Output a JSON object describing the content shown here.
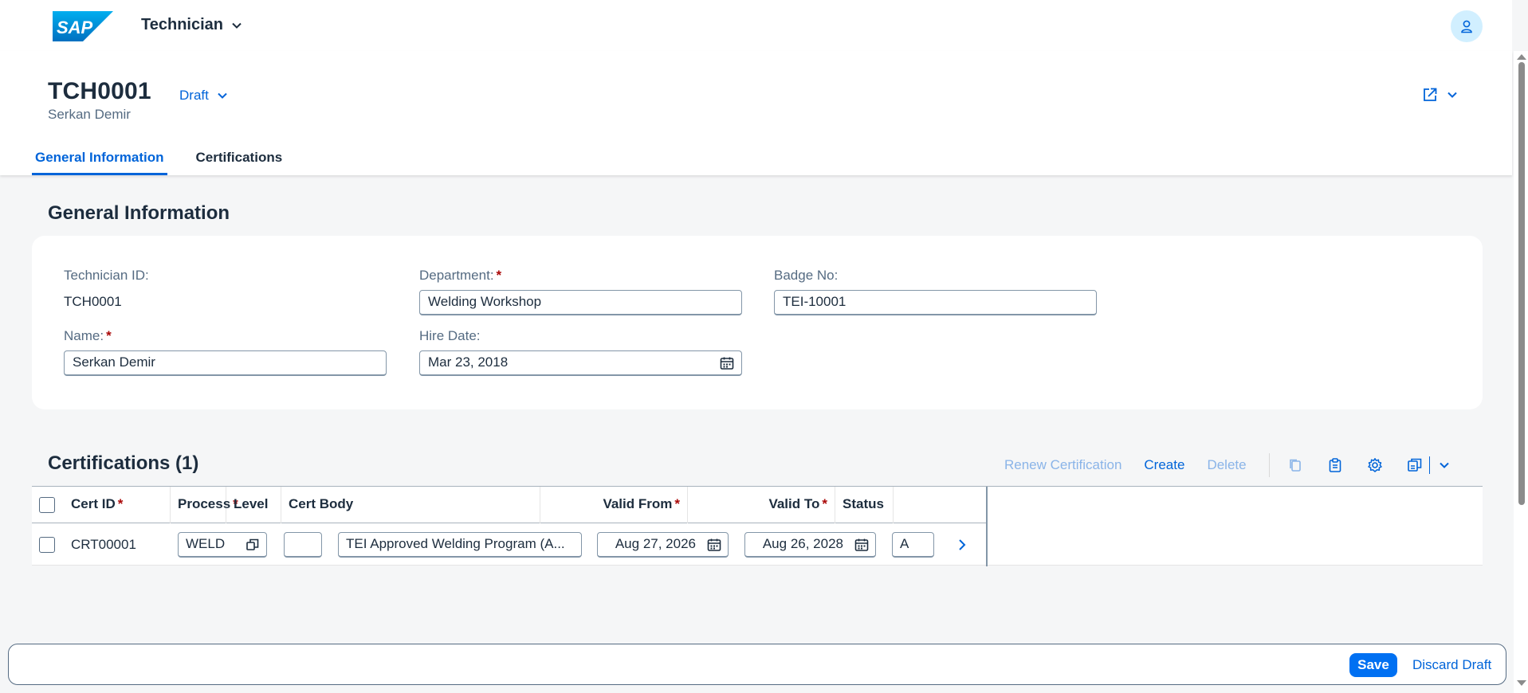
{
  "shell": {
    "logo": "SAP",
    "app_title": "Technician"
  },
  "header": {
    "title": "TCH0001",
    "subtitle": "Serkan Demir",
    "draft_label": "Draft",
    "tabs": [
      {
        "label": "General Information"
      },
      {
        "label": "Certifications"
      }
    ]
  },
  "general": {
    "title": "General Information",
    "technician_id_label": "Technician ID:",
    "technician_id_value": "TCH0001",
    "department_label": "Department:",
    "department_value": "Welding Workshop",
    "badge_label": "Badge No:",
    "badge_value": "TEI-10001",
    "name_label": "Name:",
    "name_value": "Serkan Demir",
    "hire_date_label": "Hire Date:",
    "hire_date_value": "Mar 23, 2018",
    "required_mark": "*"
  },
  "certifications": {
    "title": "Certifications (1)",
    "toolbar": {
      "renew": "Renew Certification",
      "create": "Create",
      "delete": "Delete"
    },
    "columns": [
      {
        "label": "Cert ID",
        "required": "*"
      },
      {
        "label": "Process",
        "required": "*"
      },
      {
        "label": "Level",
        "required": ""
      },
      {
        "label": "Cert Body",
        "required": ""
      },
      {
        "label": "Valid From",
        "required": "*"
      },
      {
        "label": "Valid To",
        "required": "*"
      },
      {
        "label": "Status",
        "required": ""
      }
    ],
    "rows": [
      {
        "cert_id": "CRT00001",
        "process": "WELD",
        "level": "",
        "cert_body": "TEI Approved Welding Program (A...",
        "valid_from": "Aug 27, 2026",
        "valid_to": "Aug 26, 2028",
        "status": "A"
      }
    ]
  },
  "footer": {
    "save": "Save",
    "discard": "Discard Draft"
  },
  "colors": {
    "accent": "#0064d9",
    "brand_button": "#0070f2",
    "required": "#aa0808",
    "background": "#f5f6f7"
  }
}
